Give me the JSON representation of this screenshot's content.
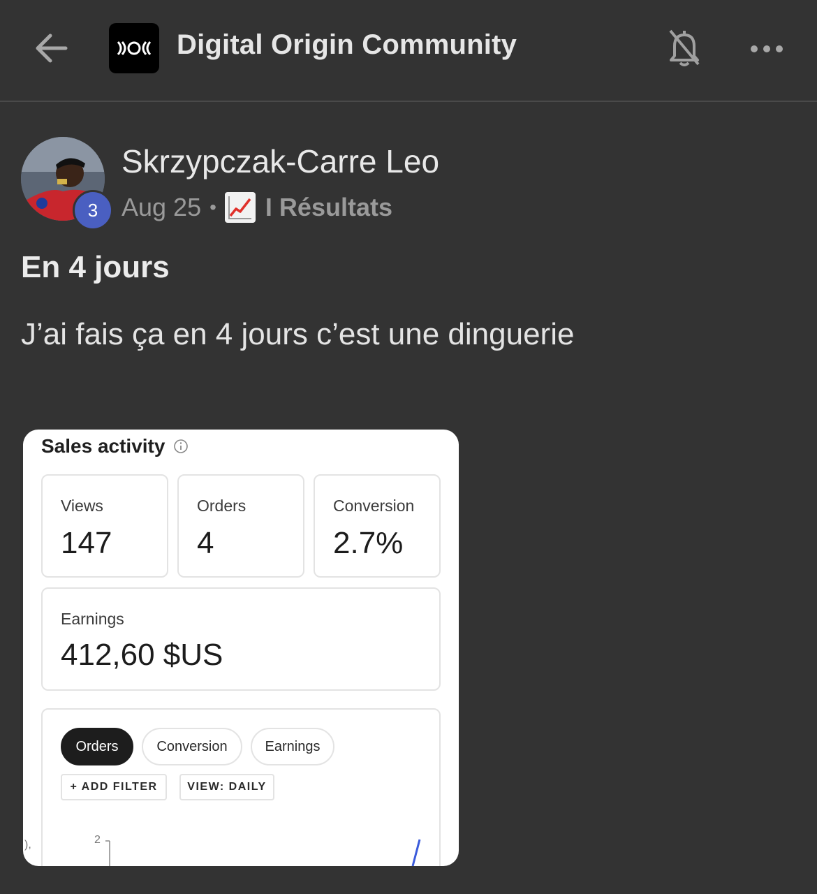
{
  "header": {
    "title": "Digital Origin Community"
  },
  "post": {
    "author": "Skrzypczak-Carre Leo",
    "level": "3",
    "date": "Aug 25",
    "separator": "•",
    "category": "I Résultats",
    "title": "En 4 jours",
    "body": "J’ai fais ça en 4 jours c’est une dinguerie"
  },
  "attachment": {
    "title": "Sales activity",
    "stats": [
      {
        "label": "Views",
        "value": "147"
      },
      {
        "label": "Orders",
        "value": "4"
      },
      {
        "label": "Conversion",
        "value": "2.7%"
      }
    ],
    "earnings": {
      "label": "Earnings",
      "value": "412,60 $US"
    },
    "tabs": [
      "Orders",
      "Conversion",
      "Earnings"
    ],
    "active_tab": "Orders",
    "add_filter": "+ ADD FILTER",
    "view": "VIEW: DAILY",
    "y_tick": "2",
    "edge_text": "),"
  },
  "colors": {
    "background": "#333333",
    "level_badge": "#4a5fc1",
    "chart_line": "#3b5bdb"
  },
  "icons": [
    "back-arrow-icon",
    "community-logo-icon",
    "bell-off-icon",
    "more-dots-icon",
    "chart-increasing-emoji-icon",
    "info-icon"
  ]
}
